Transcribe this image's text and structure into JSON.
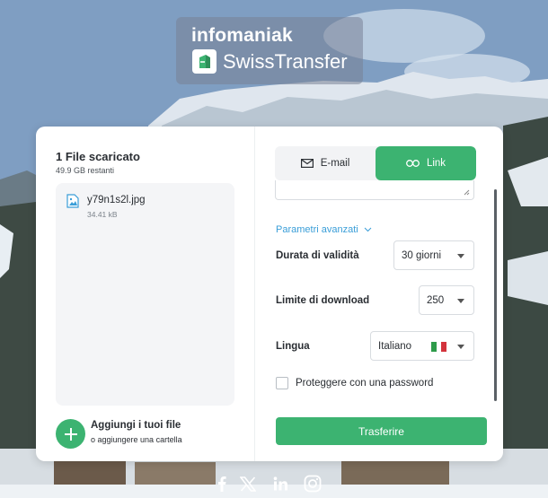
{
  "brand": {
    "company": "infomaniak",
    "product": "SwissTransfer"
  },
  "upload": {
    "title": "1 File scaricato",
    "remaining": "49.9 GB restanti",
    "files": [
      {
        "name": "y79n1s2l.jpg",
        "size": "34.41 kB",
        "icon": "image-file-icon"
      }
    ],
    "add_label": "Aggiungi i tuoi file",
    "add_sub": "o aggiungere una cartella"
  },
  "mode_toggle": {
    "email_label": "E-mail",
    "link_label": "Link",
    "selected": "Link"
  },
  "advanced": {
    "toggle_label": "Parametri avanzati",
    "validity": {
      "label": "Durata di validità",
      "value": "30 giorni"
    },
    "download_limit": {
      "label": "Limite di download",
      "value": "250"
    },
    "language": {
      "label": "Lingua",
      "value": "Italiano"
    },
    "password": {
      "label": "Proteggere con una password",
      "checked": false
    }
  },
  "submit_label": "Trasferire",
  "social": [
    "facebook-icon",
    "x-icon",
    "linkedin-icon",
    "instagram-icon"
  ],
  "colors": {
    "accent": "#3cb371",
    "link": "#3a9ed8",
    "text": "#2a2e33"
  }
}
